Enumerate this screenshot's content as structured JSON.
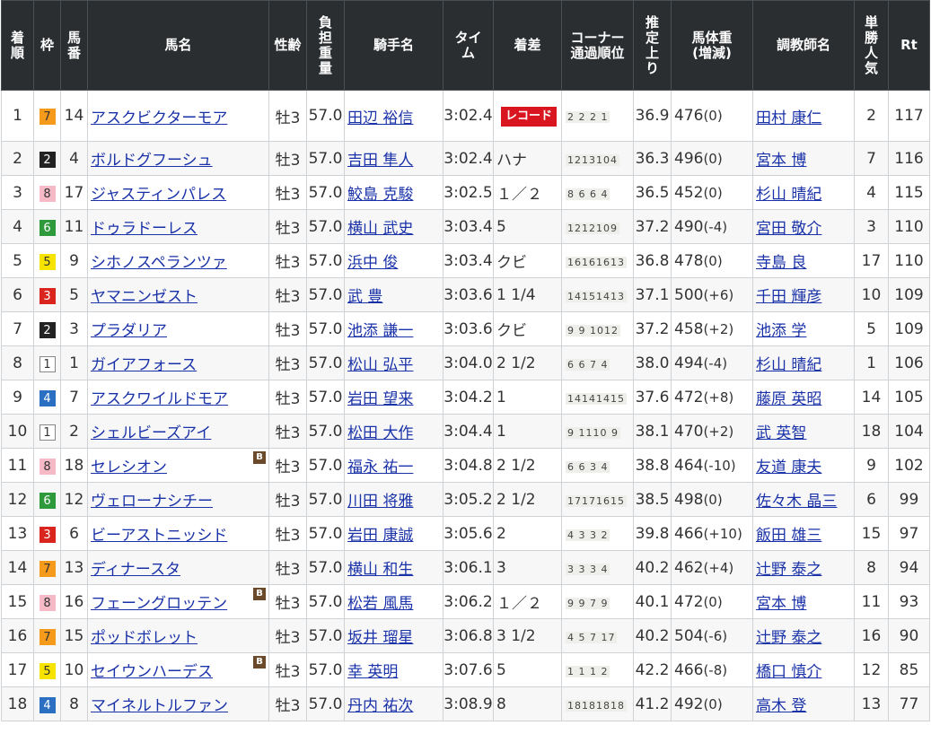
{
  "headers": {
    "rank": [
      "着",
      "順"
    ],
    "frame": "枠",
    "number": [
      "馬",
      "番"
    ],
    "horse": "馬名",
    "sexage": "性齢",
    "weight": [
      "負",
      "担",
      "重",
      "量"
    ],
    "jockey": "騎手名",
    "time": [
      "タイ",
      "ム"
    ],
    "margin": "着差",
    "corner": [
      "コーナー",
      "通過順位"
    ],
    "last3f": [
      "推",
      "定",
      "上",
      "り"
    ],
    "bodyweight": [
      "馬体重",
      "(増減)"
    ],
    "trainer": "調教師名",
    "pop": [
      "単",
      "勝",
      "人",
      "気"
    ],
    "rt": "Rt"
  },
  "blinker_label": "B",
  "frame_colors": {
    "1": {
      "bg": "#ffffff",
      "fg": "#333333",
      "border": "#888888"
    },
    "2": {
      "bg": "#222222",
      "fg": "#ffffff",
      "border": "#222222"
    },
    "3": {
      "bg": "#d9251d",
      "fg": "#ffffff",
      "border": "#d9251d"
    },
    "4": {
      "bg": "#2b6fc2",
      "fg": "#ffffff",
      "border": "#2b6fc2"
    },
    "5": {
      "bg": "#f7e300",
      "fg": "#333333",
      "border": "#f7e300"
    },
    "6": {
      "bg": "#2f9a3c",
      "fg": "#ffffff",
      "border": "#2f9a3c"
    },
    "7": {
      "bg": "#f59a1a",
      "fg": "#333333",
      "border": "#f59a1a"
    },
    "8": {
      "bg": "#f6b9c6",
      "fg": "#333333",
      "border": "#f6b9c6"
    }
  },
  "rows": [
    {
      "rank": "1",
      "frame": "7",
      "num": "14",
      "horse": "アスクビクターモア",
      "blinker": false,
      "sexage": "牡3",
      "weight": "57.0",
      "jockey": "田辺 裕信",
      "time": "3:02.4",
      "margin": "",
      "record": "レコード",
      "corner": "2 2 2 1",
      "last3f": "36.9",
      "bw": "476",
      "bwc": "(0)",
      "trainer": "田村 康仁",
      "pop": "2",
      "rt": "117"
    },
    {
      "rank": "2",
      "frame": "2",
      "num": "4",
      "horse": "ボルドグフーシュ",
      "blinker": false,
      "sexage": "牡3",
      "weight": "57.0",
      "jockey": "吉田 隼人",
      "time": "3:02.4",
      "margin": "ハナ",
      "record": "",
      "corner": "1213104",
      "last3f": "36.3",
      "bw": "496",
      "bwc": "(0)",
      "trainer": "宮本 博",
      "pop": "7",
      "rt": "116"
    },
    {
      "rank": "3",
      "frame": "8",
      "num": "17",
      "horse": "ジャスティンパレス",
      "blinker": false,
      "sexage": "牡3",
      "weight": "57.0",
      "jockey": "鮫島 克駿",
      "time": "3:02.5",
      "margin": "１／２",
      "record": "",
      "corner": "8 6 6 4",
      "last3f": "36.5",
      "bw": "452",
      "bwc": "(0)",
      "trainer": "杉山 晴紀",
      "pop": "4",
      "rt": "115"
    },
    {
      "rank": "4",
      "frame": "6",
      "num": "11",
      "horse": "ドゥラドーレス",
      "blinker": false,
      "sexage": "牡3",
      "weight": "57.0",
      "jockey": "横山 武史",
      "time": "3:03.4",
      "margin": "5",
      "record": "",
      "corner": "1212109",
      "last3f": "37.2",
      "bw": "490",
      "bwc": "(-4)",
      "trainer": "宮田 敬介",
      "pop": "3",
      "rt": "110"
    },
    {
      "rank": "5",
      "frame": "5",
      "num": "9",
      "horse": "シホノスペランツァ",
      "blinker": false,
      "sexage": "牡3",
      "weight": "57.0",
      "jockey": "浜中 俊",
      "time": "3:03.4",
      "margin": "クビ",
      "record": "",
      "corner": "16161613",
      "last3f": "36.8",
      "bw": "478",
      "bwc": "(0)",
      "trainer": "寺島 良",
      "pop": "17",
      "rt": "110"
    },
    {
      "rank": "6",
      "frame": "3",
      "num": "5",
      "horse": "ヤマニンゼスト",
      "blinker": false,
      "sexage": "牡3",
      "weight": "57.0",
      "jockey": "武 豊",
      "time": "3:03.6",
      "margin": "1 1/4",
      "record": "",
      "corner": "14151413",
      "last3f": "37.1",
      "bw": "500",
      "bwc": "(+6)",
      "trainer": "千田 輝彦",
      "pop": "10",
      "rt": "109"
    },
    {
      "rank": "7",
      "frame": "2",
      "num": "3",
      "horse": "プラダリア",
      "blinker": false,
      "sexage": "牡3",
      "weight": "57.0",
      "jockey": "池添 謙一",
      "time": "3:03.6",
      "margin": "クビ",
      "record": "",
      "corner": "9 9 1012",
      "last3f": "37.2",
      "bw": "458",
      "bwc": "(+2)",
      "trainer": "池添 学",
      "pop": "5",
      "rt": "109"
    },
    {
      "rank": "8",
      "frame": "1",
      "num": "1",
      "horse": "ガイアフォース",
      "blinker": false,
      "sexage": "牡3",
      "weight": "57.0",
      "jockey": "松山 弘平",
      "time": "3:04.0",
      "margin": "2 1/2",
      "record": "",
      "corner": "6 6 7 4",
      "last3f": "38.0",
      "bw": "494",
      "bwc": "(-4)",
      "trainer": "杉山 晴紀",
      "pop": "1",
      "rt": "106"
    },
    {
      "rank": "9",
      "frame": "4",
      "num": "7",
      "horse": "アスクワイルドモア",
      "blinker": false,
      "sexage": "牡3",
      "weight": "57.0",
      "jockey": "岩田 望来",
      "time": "3:04.2",
      "margin": "1",
      "record": "",
      "corner": "14141415",
      "last3f": "37.6",
      "bw": "472",
      "bwc": "(+8)",
      "trainer": "藤原 英昭",
      "pop": "14",
      "rt": "105"
    },
    {
      "rank": "10",
      "frame": "1",
      "num": "2",
      "horse": "シェルビーズアイ",
      "blinker": false,
      "sexage": "牡3",
      "weight": "57.0",
      "jockey": "松田 大作",
      "time": "3:04.4",
      "margin": "1",
      "record": "",
      "corner": "9 1110 9",
      "last3f": "38.1",
      "bw": "470",
      "bwc": "(+2)",
      "trainer": "武 英智",
      "pop": "18",
      "rt": "104"
    },
    {
      "rank": "11",
      "frame": "8",
      "num": "18",
      "horse": "セレシオン",
      "blinker": true,
      "sexage": "牡3",
      "weight": "57.0",
      "jockey": "福永 祐一",
      "time": "3:04.8",
      "margin": "2 1/2",
      "record": "",
      "corner": "6 6 3 4",
      "last3f": "38.8",
      "bw": "464",
      "bwc": "(-10)",
      "trainer": "友道 康夫",
      "pop": "9",
      "rt": "102"
    },
    {
      "rank": "12",
      "frame": "6",
      "num": "12",
      "horse": "ヴェローナシチー",
      "blinker": false,
      "sexage": "牡3",
      "weight": "57.0",
      "jockey": "川田 将雅",
      "time": "3:05.2",
      "margin": "2 1/2",
      "record": "",
      "corner": "17171615",
      "last3f": "38.5",
      "bw": "498",
      "bwc": "(0)",
      "trainer": "佐々木 晶三",
      "pop": "6",
      "rt": "99"
    },
    {
      "rank": "13",
      "frame": "3",
      "num": "6",
      "horse": "ビーアストニッシド",
      "blinker": false,
      "sexage": "牡3",
      "weight": "57.0",
      "jockey": "岩田 康誠",
      "time": "3:05.6",
      "margin": "2",
      "record": "",
      "corner": "4 3 3 2",
      "last3f": "39.8",
      "bw": "466",
      "bwc": "(+10)",
      "trainer": "飯田 雄三",
      "pop": "15",
      "rt": "97"
    },
    {
      "rank": "14",
      "frame": "7",
      "num": "13",
      "horse": "ディナースタ",
      "blinker": false,
      "sexage": "牡3",
      "weight": "57.0",
      "jockey": "横山 和生",
      "time": "3:06.1",
      "margin": "3",
      "record": "",
      "corner": "3 3 3 4",
      "last3f": "40.2",
      "bw": "462",
      "bwc": "(+4)",
      "trainer": "辻野 泰之",
      "pop": "8",
      "rt": "94"
    },
    {
      "rank": "15",
      "frame": "8",
      "num": "16",
      "horse": "フェーングロッテン",
      "blinker": true,
      "sexage": "牡3",
      "weight": "57.0",
      "jockey": "松若 風馬",
      "time": "3:06.2",
      "margin": "１／２",
      "record": "",
      "corner": "9 9 7 9",
      "last3f": "40.1",
      "bw": "472",
      "bwc": "(0)",
      "trainer": "宮本 博",
      "pop": "11",
      "rt": "93"
    },
    {
      "rank": "16",
      "frame": "7",
      "num": "15",
      "horse": "ポッドボレット",
      "blinker": false,
      "sexage": "牡3",
      "weight": "57.0",
      "jockey": "坂井 瑠星",
      "time": "3:06.8",
      "margin": "3 1/2",
      "record": "",
      "corner": "4 5 7 17",
      "last3f": "40.2",
      "bw": "504",
      "bwc": "(-6)",
      "trainer": "辻野 泰之",
      "pop": "16",
      "rt": "90"
    },
    {
      "rank": "17",
      "frame": "5",
      "num": "10",
      "horse": "セイウンハーデス",
      "blinker": true,
      "sexage": "牡3",
      "weight": "57.0",
      "jockey": "幸 英明",
      "time": "3:07.6",
      "margin": "5",
      "record": "",
      "corner": "1 1 1 2",
      "last3f": "42.2",
      "bw": "466",
      "bwc": "(-8)",
      "trainer": "橋口 慎介",
      "pop": "12",
      "rt": "85"
    },
    {
      "rank": "18",
      "frame": "4",
      "num": "8",
      "horse": "マイネルトルファン",
      "blinker": false,
      "sexage": "牡3",
      "weight": "57.0",
      "jockey": "丹内 祐次",
      "time": "3:08.9",
      "margin": "8",
      "record": "",
      "corner": "18181818",
      "last3f": "41.2",
      "bw": "492",
      "bwc": "(0)",
      "trainer": "高木 登",
      "pop": "13",
      "rt": "77"
    }
  ]
}
